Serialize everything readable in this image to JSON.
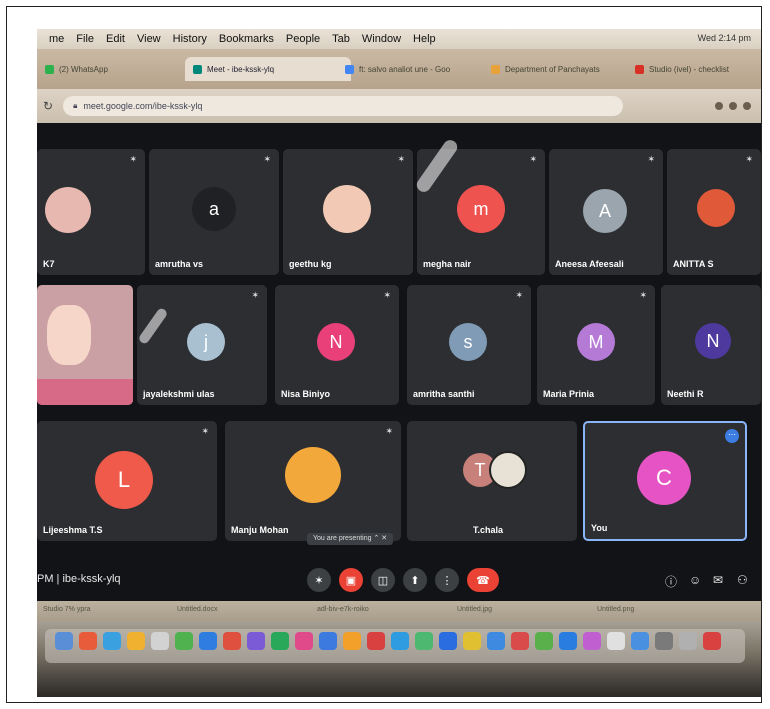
{
  "menubar": {
    "items": [
      "me",
      "File",
      "Edit",
      "View",
      "History",
      "Bookmarks",
      "People",
      "Tab",
      "Window",
      "Help"
    ],
    "status": "Wed 2:14 pm"
  },
  "tabs": [
    {
      "label": "(2) WhatsApp",
      "color": "#2bb24c"
    },
    {
      "label": "Meet - ibe-kssk-ylq",
      "color": "#00897b"
    },
    {
      "label": "ft: salvo analiot une - Goo",
      "color": "#4285f4"
    },
    {
      "label": "Department of Panchayats",
      "color": "#e8a23a"
    },
    {
      "label": "Studio (ivel) - checklist",
      "color": "#d93025"
    }
  ],
  "address": {
    "url": "meet.google.com/ibe-kssk-ylq"
  },
  "participants": [
    {
      "name": "K7",
      "initial": "",
      "color": "#e7b8b0",
      "kind": "photo"
    },
    {
      "name": "amrutha vs",
      "initial": "a",
      "color": "#202124",
      "kind": "letter"
    },
    {
      "name": "geethu kg",
      "initial": "",
      "color": "#f1c9b4",
      "kind": "photo"
    },
    {
      "name": "megha nair",
      "initial": "m",
      "color": "#ef5350",
      "kind": "letter"
    },
    {
      "name": "Aneesa Afeesali",
      "initial": "A",
      "color": "#9aa5ae",
      "kind": "letter"
    },
    {
      "name": "ANITTA S",
      "initial": "",
      "color": "#e05a3a",
      "kind": "photo"
    },
    {
      "name": "",
      "initial": "",
      "color": "#f6d6c8",
      "kind": "video"
    },
    {
      "name": "jayalekshmi ulas",
      "initial": "j",
      "color": "#a9c0d1",
      "kind": "letter"
    },
    {
      "name": "Nisa Biniyo",
      "initial": "N",
      "color": "#e9407a",
      "kind": "letter"
    },
    {
      "name": "amritha santhi",
      "initial": "s",
      "color": "#7f9bb5",
      "kind": "letter"
    },
    {
      "name": "Maria Prinia",
      "initial": "M",
      "color": "#b57ad6",
      "kind": "letter"
    },
    {
      "name": "Neethi R",
      "initial": "N",
      "color": "#4e3a9e",
      "kind": "letter"
    },
    {
      "name": "Lijeeshma T.S",
      "initial": "L",
      "color": "#f05a4a",
      "kind": "letter"
    },
    {
      "name": "Manju Mohan",
      "initial": "",
      "color": "#f3a83b",
      "kind": "photo"
    },
    {
      "name": "T.chala",
      "initial": "T",
      "color": "#c7807a",
      "kind": "letter"
    },
    {
      "name": "You",
      "initial": "C",
      "color": "#e653c4",
      "kind": "letter"
    }
  ],
  "caption": "You are presenting ⌃ ✕",
  "controls": {
    "meeting_code": "PM | ibe-kssk-ylq",
    "buttons": [
      "mic-off",
      "mic",
      "captions",
      "present",
      "more",
      "end-call"
    ]
  },
  "icons": {
    "mic_off": "✶",
    "hangup": "☎",
    "info": "ⓘ",
    "people": "☺",
    "chat": "✉",
    "activities": "⚇"
  },
  "statusbar": [
    "Studio 7% ypra",
    "Untitled.docx",
    "adl-biv-e7k-roiko",
    "Untitled.jpg",
    "Untitled.png"
  ]
}
